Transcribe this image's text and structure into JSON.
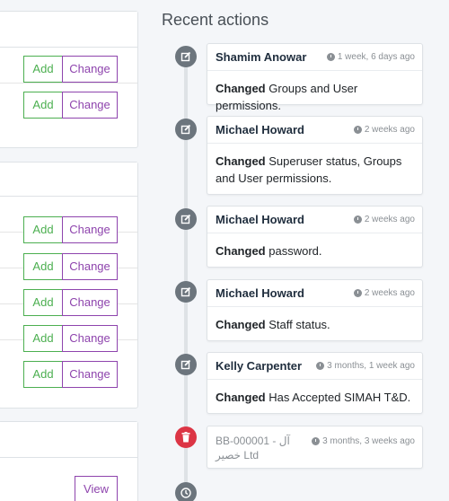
{
  "permission_buttons": {
    "add": "Add",
    "change": "Change",
    "view": "View"
  },
  "recent_actions": {
    "title": "Recent actions",
    "items": [
      {
        "user": "Shamim Anowar",
        "time": "1 week, 6 days ago",
        "verb": "Changed",
        "detail": "Groups and User permissions."
      },
      {
        "user": "Michael Howard",
        "time": "2 weeks ago",
        "verb": "Changed",
        "detail": "Superuser status, Groups and User permissions."
      },
      {
        "user": "Michael Howard",
        "time": "2 weeks ago",
        "verb": "Changed",
        "detail": "password."
      },
      {
        "user": "Michael Howard",
        "time": "2 weeks ago",
        "verb": "Changed",
        "detail": "Staff status."
      },
      {
        "user": "Kelly Carpenter",
        "time": "3 months, 1 week ago",
        "verb": "Changed",
        "detail": "Has Accepted SIMAH T&D."
      }
    ],
    "deleted_item": {
      "object": "BB-000001 - آل خصير Ltd",
      "time": "3 months, 3 weeks ago"
    }
  },
  "icons": {
    "edit": "edit-icon",
    "delete": "trash-icon",
    "clock": "clock-icon",
    "accent_colors": {
      "add": "#4caf50",
      "change": "#8e44ad",
      "delete": "#dc3545"
    }
  }
}
